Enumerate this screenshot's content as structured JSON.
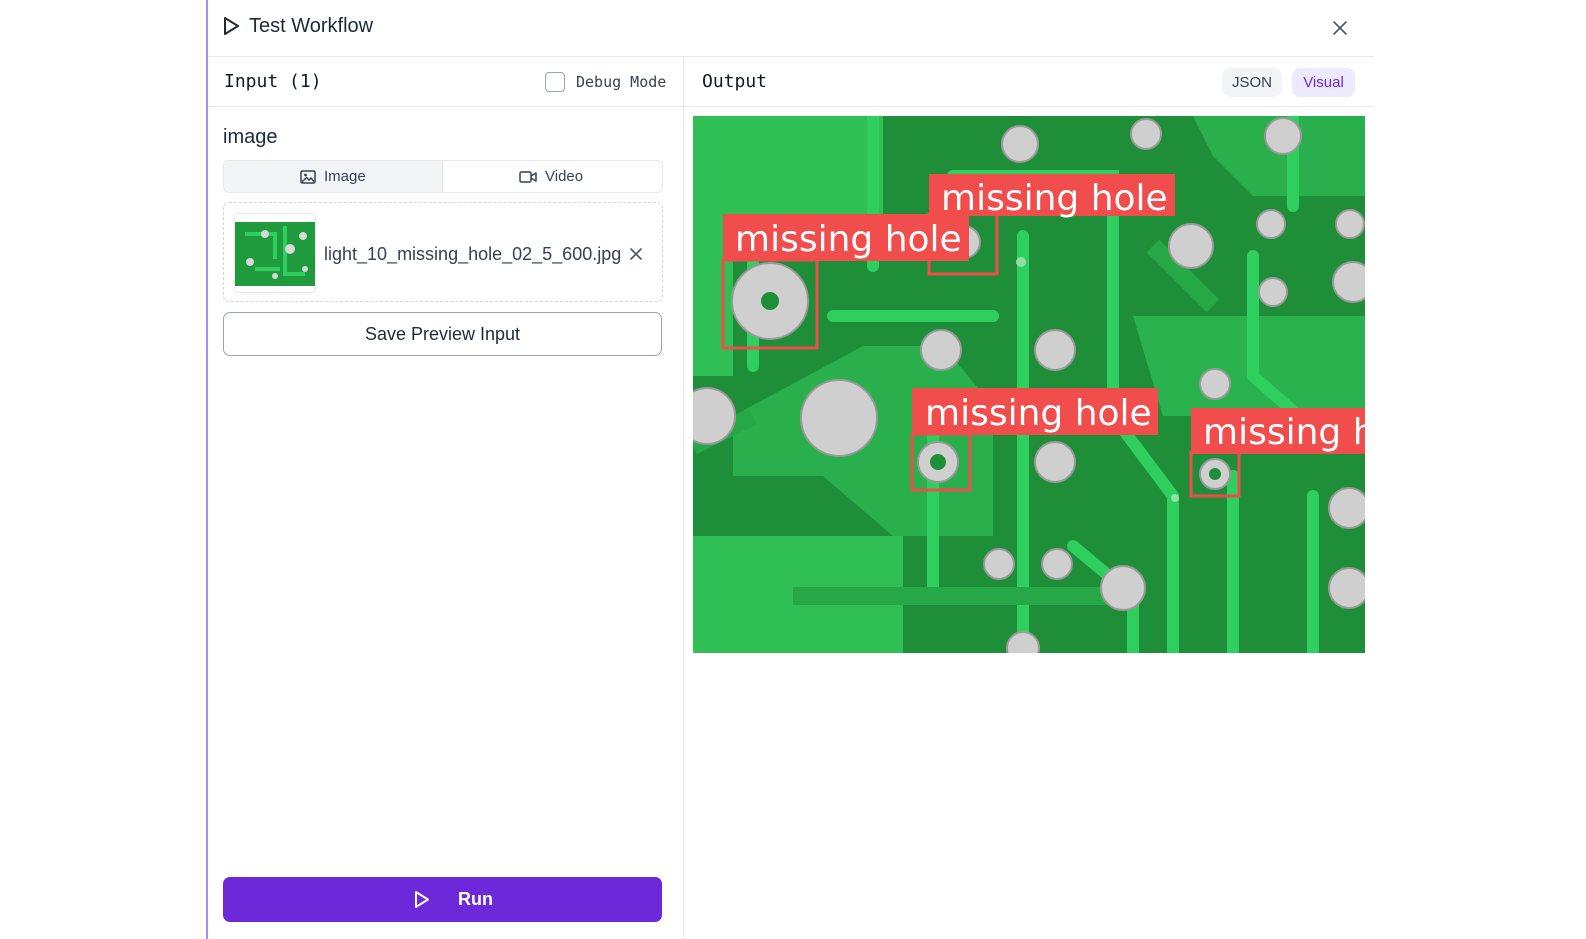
{
  "window": {
    "title": "Test Workflow"
  },
  "input": {
    "header": "Input (1)",
    "debug_mode_label": "Debug Mode",
    "debug_mode_checked": false,
    "field_label": "image",
    "media_tabs": {
      "image": "Image",
      "video": "Video",
      "selected": "Image"
    },
    "file_name": "light_10_missing_hole_02_5_600.jpg",
    "save_button": "Save Preview Input",
    "run_button": "Run"
  },
  "output": {
    "header": "Output",
    "tabs": {
      "json": "JSON",
      "visual": "Visual",
      "selected": "Visual"
    },
    "detections": [
      {
        "label": "missing hole"
      },
      {
        "label": "missing hole"
      },
      {
        "label": "missing hole"
      },
      {
        "label": "missing hole"
      }
    ]
  },
  "colors": {
    "accent": "#6d28d9",
    "accent_light": "#ede9fe",
    "detection": "#f14d4d",
    "pcb_green": "#1f9a3c"
  },
  "icons": {
    "title": "play-icon",
    "close": "close-icon",
    "image_tab": "image-icon",
    "video_tab": "video-icon",
    "remove": "close-icon",
    "run": "play-icon"
  }
}
